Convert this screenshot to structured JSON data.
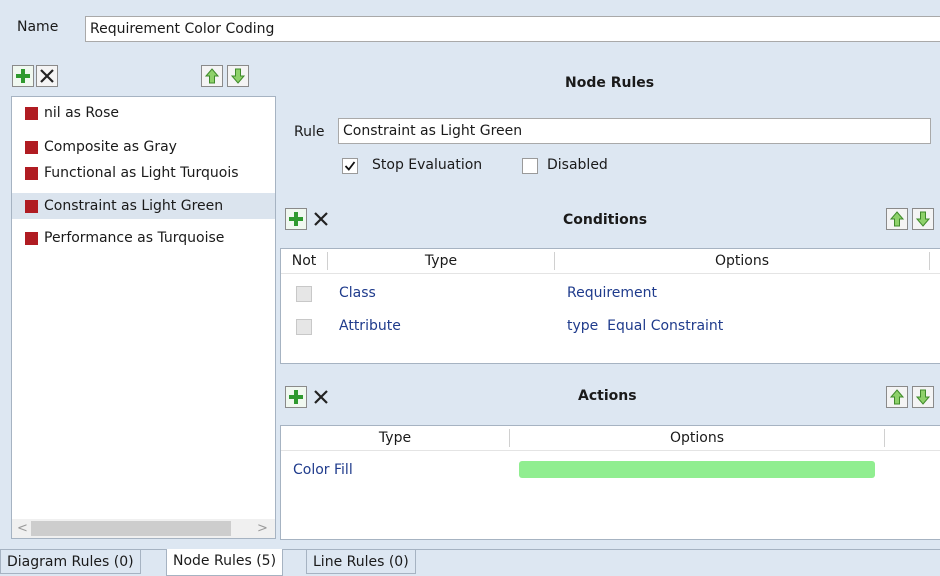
{
  "header": {
    "name_label": "Name",
    "name_value": "Requirement Color Coding"
  },
  "rules_list": {
    "items": [
      {
        "label": "nil as Rose"
      },
      {
        "label": "Composite as Gray"
      },
      {
        "label": "Functional as Light Turquois"
      },
      {
        "label": "Constraint as Light Green",
        "selected": true
      },
      {
        "label": "Performance as Turquoise"
      }
    ],
    "swatch_color": "#b01c22"
  },
  "node_rules": {
    "title": "Node Rules",
    "rule_label": "Rule",
    "rule_value": "Constraint as Light Green",
    "stop_evaluation_label": "Stop Evaluation",
    "stop_evaluation_checked": true,
    "disabled_label": "Disabled",
    "disabled_checked": false
  },
  "conditions": {
    "title": "Conditions",
    "columns": [
      "Not",
      "Type",
      "Options"
    ],
    "rows": [
      {
        "type": "Class",
        "options": "Requirement"
      },
      {
        "type": "Attribute",
        "options": "type  Equal Constraint"
      }
    ]
  },
  "actions": {
    "title": "Actions",
    "columns": [
      "Type",
      "Options"
    ],
    "rows": [
      {
        "type": "Color Fill",
        "color": "#90ee90"
      }
    ]
  },
  "tabs": [
    {
      "label": "Diagram Rules (0)"
    },
    {
      "label": "Node Rules (5)",
      "active": true
    },
    {
      "label": "Line Rules (0)"
    }
  ],
  "icons": {
    "add": "plus-icon",
    "delete": "x-icon",
    "move_up": "arrow-up-icon",
    "move_down": "arrow-down-icon",
    "scroll_left": "chevron-left-icon",
    "scroll_right": "chevron-right-icon"
  }
}
